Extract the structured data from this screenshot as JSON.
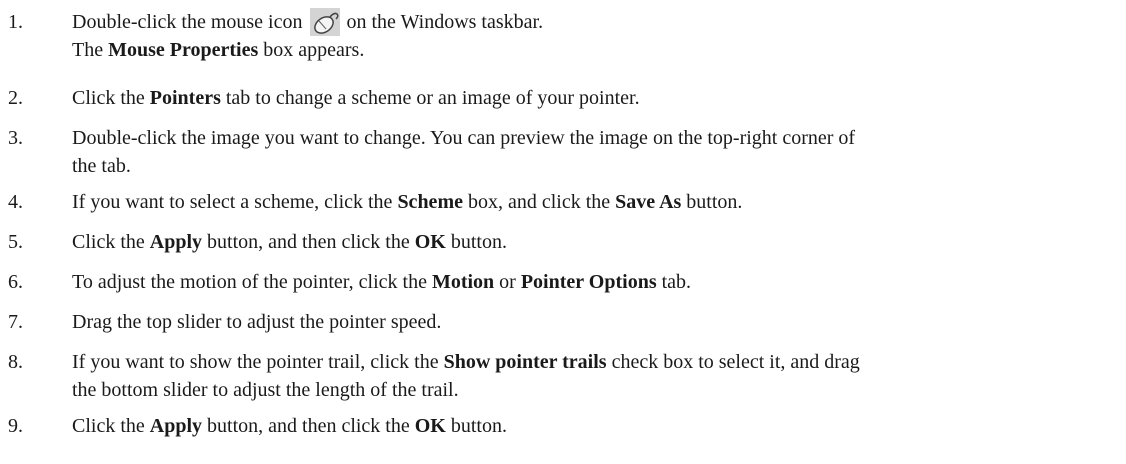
{
  "steps": [
    {
      "num": "1.",
      "lines": [
        [
          {
            "t": "Double-click the mouse icon "
          },
          {
            "icon": "mouse-icon"
          },
          {
            "t": " on the Windows taskbar."
          }
        ],
        [
          {
            "t": "The "
          },
          {
            "b": "Mouse Properties"
          },
          {
            "t": " box appears."
          }
        ]
      ]
    },
    {
      "num": "2.",
      "lines": [
        [
          {
            "t": "Click the "
          },
          {
            "b": "Pointers"
          },
          {
            "t": " tab to change a scheme or an image of your pointer."
          }
        ]
      ]
    },
    {
      "num": "3.",
      "lines": [
        [
          {
            "t": "Double-click the image you want to change. You can preview the image on the top-right corner of"
          }
        ],
        [
          {
            "t": "the tab."
          }
        ]
      ]
    },
    {
      "num": "4.",
      "lines": [
        [
          {
            "t": "If you want to select a scheme, click the "
          },
          {
            "b": "Scheme"
          },
          {
            "t": " box, and click the "
          },
          {
            "b": "Save As"
          },
          {
            "t": " button."
          }
        ]
      ]
    },
    {
      "num": "5.",
      "lines": [
        [
          {
            "t": "Click the "
          },
          {
            "b": "Apply"
          },
          {
            "t": " button, and then click the "
          },
          {
            "b": "OK"
          },
          {
            "t": " button."
          }
        ]
      ]
    },
    {
      "num": "6.",
      "lines": [
        [
          {
            "t": "To adjust the motion of the pointer, click the "
          },
          {
            "b": "Motion"
          },
          {
            "t": " or "
          },
          {
            "b": "Pointer Options"
          },
          {
            "t": " tab."
          }
        ]
      ]
    },
    {
      "num": "7.",
      "lines": [
        [
          {
            "t": "Drag the top slider to adjust the pointer speed."
          }
        ]
      ]
    },
    {
      "num": "8.",
      "lines": [
        [
          {
            "t": "If you want to show the pointer trail, click the "
          },
          {
            "b": "Show pointer trails"
          },
          {
            "t": " check box to select it, and drag"
          }
        ],
        [
          {
            "t": "the bottom slider to adjust the length of the trail."
          }
        ]
      ]
    },
    {
      "num": "9.",
      "lines": [
        [
          {
            "t": "Click the "
          },
          {
            "b": "Apply"
          },
          {
            "t": " button, and then click the "
          },
          {
            "b": "OK"
          },
          {
            "t": " button."
          }
        ]
      ]
    }
  ]
}
